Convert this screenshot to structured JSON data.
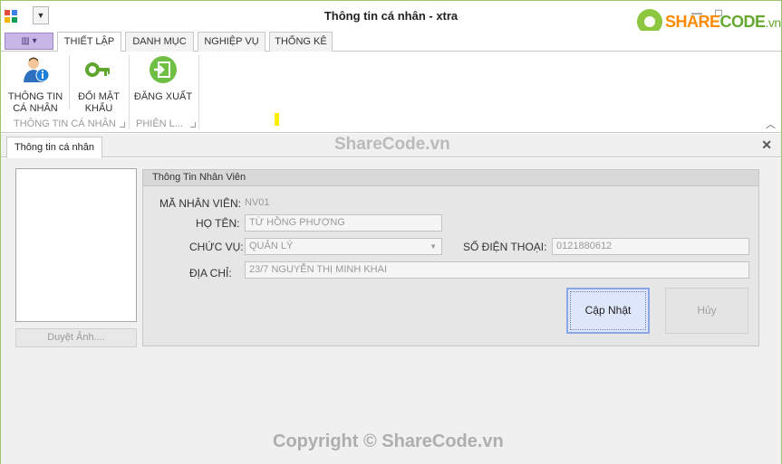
{
  "window": {
    "title": "Thông tin cá nhân - xtra"
  },
  "logo": {
    "part1": "SHARE",
    "part2": "CODE",
    "part3": ".vn"
  },
  "ribbon_tabs": [
    "THIẾT LẬP",
    "DANH MỤC",
    "NGHIỆP VỤ",
    "THỐNG KÊ"
  ],
  "ribbon": {
    "buttons": {
      "profile": "THÔNG TIN CÁ NHÂN",
      "change_password": "ĐỔI MẬT KHẨU",
      "logout": "ĐĂNG XUẤT"
    },
    "groups": {
      "profile_group": "THÔNG TIN CÁ NHÂN",
      "session_group": "PHIÊN L..."
    }
  },
  "document_tab": {
    "label": "Thông tin cá nhân"
  },
  "photo": {
    "browse_label": "Duyệt Ảnh...."
  },
  "form": {
    "caption": "Thông Tin Nhân Viên",
    "employee_id_label": "MÃ NHÂN VIÊN:",
    "employee_id_value": "NV01",
    "name_label": "HỌ TÊN:",
    "name_value": "TỪ HỒNG PHƯỢNG",
    "position_label": "CHỨC VỤ:",
    "position_value": "QUẢN LÝ",
    "phone_label": "SỐ ĐIỆN THOẠI:",
    "phone_value": "0121880612",
    "address_label": "ĐỊA CHỈ:",
    "address_value": "23/7 NGUYỄN THỊ MINH KHAI",
    "update_label": "Cập Nhật",
    "cancel_label": "Hủy"
  },
  "watermark": {
    "top": "ShareCode.vn",
    "bottom": "Copyright © ShareCode.vn"
  },
  "colors": {
    "accent": "#8dc63f",
    "ribbon_menu": "#c8b6e6",
    "highlight": "#ffee00"
  }
}
